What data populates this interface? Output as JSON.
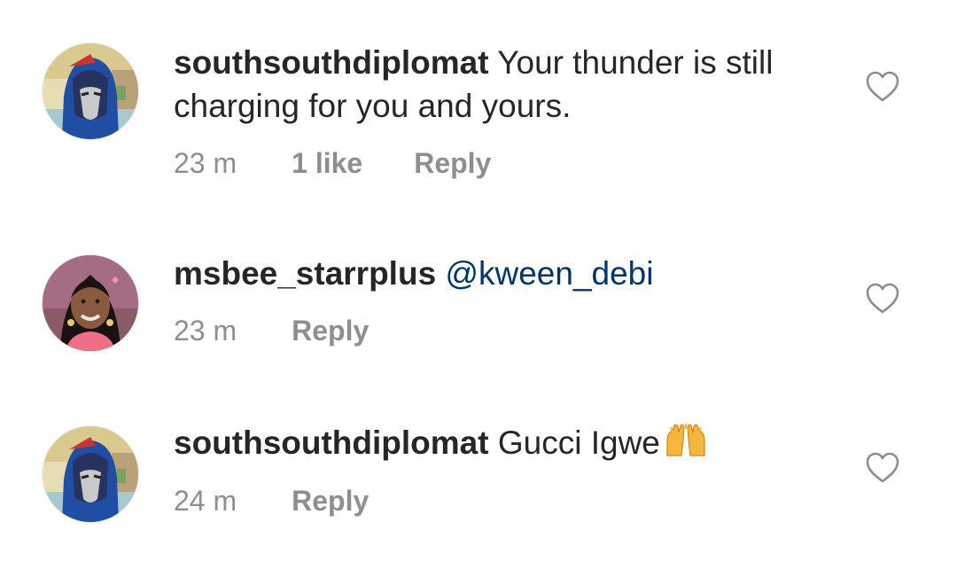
{
  "comments": [
    {
      "username": "southsouthdiplomat",
      "text": "Your thunder is still charging for you and yours.",
      "time": "23 m",
      "likes": "1 like",
      "reply": "Reply",
      "avatar": "cartoon-character-avatar-icon"
    },
    {
      "username": "msbee_starrplus",
      "mention": "@kween_debi",
      "time": "23 m",
      "reply": "Reply",
      "avatar": "profile-photo-avatar"
    },
    {
      "username": "southsouthdiplomat",
      "text": "Gucci Igwe",
      "emoji": "raising-hands-emoji-icon",
      "time": "24 m",
      "reply": "Reply",
      "avatar": "cartoon-character-avatar-icon"
    }
  ],
  "icons": {
    "like": "heart-outline-icon"
  },
  "colors": {
    "text": "#262626",
    "meta": "#8e8e8e",
    "mention": "#003569"
  }
}
